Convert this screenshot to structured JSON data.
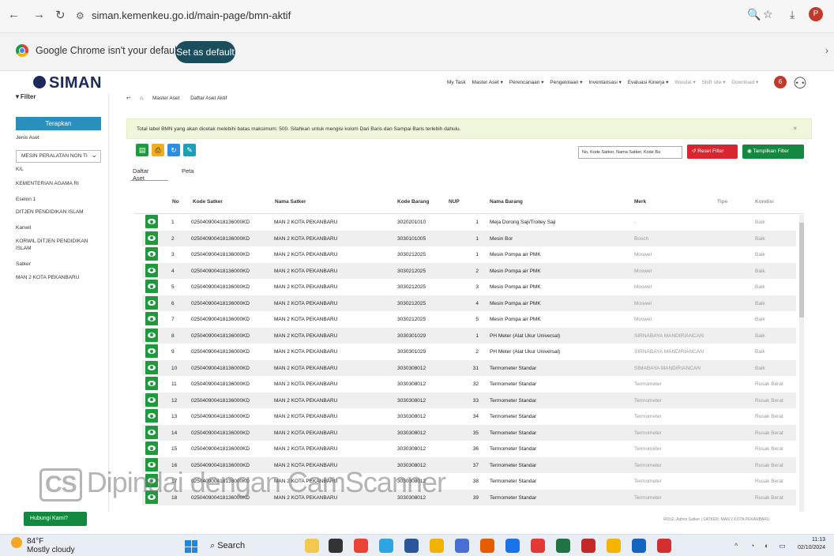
{
  "browser": {
    "url": "siman.kemenkeu.go.id/main-page/bmn-aktif",
    "infobar_text": "Google Chrome isn't your default browser",
    "set_default_label": "Set as default"
  },
  "app": {
    "logo": "SIMAN",
    "nav": [
      "My Task",
      "Master Aset ▾",
      "Perencanaan ▾",
      "Pengelolaan ▾",
      "Inventarisasi ▾",
      "Evaluasi Kinerja ▾",
      "Wasdal ▾",
      "Shift site ▾",
      "Download ▾"
    ],
    "notif_count": "6"
  },
  "sidebar": {
    "filter_label": "Filter",
    "apply_label": "Terapkan",
    "fields": [
      {
        "label": "Jenis Aset",
        "value": "MESIN PERALATAN NON TI"
      },
      {
        "label": "K/L",
        "value": "KEMENTERIAN AGAMA RI"
      },
      {
        "label": "Eselon 1",
        "value": "DITJEN PENDIDIKAN ISLAM"
      },
      {
        "label": "Kanwil",
        "value": "KORWIL DITJEN PENDIDIKAN ISLAM"
      },
      {
        "label": "Satker",
        "value": "MAN 2 KOTA PEKANBARU"
      }
    ]
  },
  "breadcrumb": [
    "Master Aset",
    "Daftar Aset Aktif"
  ],
  "alert": {
    "text": "Total label BMN yang akan dicetak melebihi batas maksimum: 500. Silahkan untuk mengisi kolom Dari Baris dan Sampai Baris terlebih dahulu.",
    "close": "×"
  },
  "toolbar": {
    "search_placeholder": "No, Kode Satker, Nama Satker, Kode Ba",
    "reset_label": "Reset Filter",
    "show_label": "Tampilkan Filter"
  },
  "tabs": [
    "Daftar Aset",
    "Peta"
  ],
  "table": {
    "headers": [
      "No",
      "Kode Satker",
      "Nama Satker",
      "Kode Barang",
      "NUP",
      "Nama Barang",
      "Merk",
      "Tipe",
      "Kondisi"
    ],
    "rows": [
      {
        "no": "1",
        "kode_satker": "025040900418136000KD",
        "nama_satker": "MAN 2 KOTA PEKANBARU",
        "kode_barang": "3020201010",
        "nup": "1",
        "nama_barang": "Meja Dorong Saji/Trolley Saji",
        "merk": "-",
        "kondisi": "Baik"
      },
      {
        "no": "2",
        "kode_satker": "025040900418136000KD",
        "nama_satker": "MAN 2 KOTA PEKANBARU",
        "kode_barang": "3030101005",
        "nup": "1",
        "nama_barang": "Mesin Bor",
        "merk": "Bosch",
        "kondisi": "Baik"
      },
      {
        "no": "3",
        "kode_satker": "025040900418136000KD",
        "nama_satker": "MAN 2 KOTA PEKANBARU",
        "kode_barang": "3030212025",
        "nup": "1",
        "nama_barang": "Mesin Pompa air PMK",
        "merk": "Moswel",
        "kondisi": "Baik"
      },
      {
        "no": "4",
        "kode_satker": "025040900418136000KD",
        "nama_satker": "MAN 2 KOTA PEKANBARU",
        "kode_barang": "3030212025",
        "nup": "2",
        "nama_barang": "Mesin Pompa air PMK",
        "merk": "Moswel",
        "kondisi": "Baik"
      },
      {
        "no": "5",
        "kode_satker": "025040900418136000KD",
        "nama_satker": "MAN 2 KOTA PEKANBARU",
        "kode_barang": "3030212025",
        "nup": "3",
        "nama_barang": "Mesin Pompa air PMK",
        "merk": "Moswel",
        "kondisi": "Baik"
      },
      {
        "no": "6",
        "kode_satker": "025040900418136000KD",
        "nama_satker": "MAN 2 KOTA PEKANBARU",
        "kode_barang": "3030212025",
        "nup": "4",
        "nama_barang": "Mesin Pompa air PMK",
        "merk": "Moswel",
        "kondisi": "Baik"
      },
      {
        "no": "7",
        "kode_satker": "025040900418136000KD",
        "nama_satker": "MAN 2 KOTA PEKANBARU",
        "kode_barang": "3030212025",
        "nup": "5",
        "nama_barang": "Mesin Pompa air PMK",
        "merk": "Moswel",
        "kondisi": "Baik"
      },
      {
        "no": "8",
        "kode_satker": "025040900418136000KD",
        "nama_satker": "MAN 2 KOTA PEKANBARU",
        "kode_barang": "3030301029",
        "nup": "1",
        "nama_barang": "PH Meter (Alat Ukur Universal)",
        "merk": "SIRNABAYA MANDIRIANCAN",
        "kondisi": "Baik"
      },
      {
        "no": "9",
        "kode_satker": "025040900418136000KD",
        "nama_satker": "MAN 2 KOTA PEKANBARU",
        "kode_barang": "3030301029",
        "nup": "2",
        "nama_barang": "PH Meter (Alat Ukur Universal)",
        "merk": "SIRNABAYA MANDIRIANCAN",
        "kondisi": "Baik"
      },
      {
        "no": "10",
        "kode_satker": "025040900418136000KD",
        "nama_satker": "MAN 2 KOTA PEKANBARU",
        "kode_barang": "3030308012",
        "nup": "31",
        "nama_barang": "Termometer Standar",
        "merk": "SIMABAYA MANDIRIANCAN",
        "kondisi": "Baik"
      },
      {
        "no": "11",
        "kode_satker": "025040900418136000KD",
        "nama_satker": "MAN 2 KOTA PEKANBARU",
        "kode_barang": "3030308012",
        "nup": "32",
        "nama_barang": "Termometer Standar",
        "merk": "Termometer",
        "kondisi": "Rusak Berat"
      },
      {
        "no": "12",
        "kode_satker": "025040900418136000KD",
        "nama_satker": "MAN 2 KOTA PEKANBARU",
        "kode_barang": "3030308012",
        "nup": "33",
        "nama_barang": "Termometer Standar",
        "merk": "Termometer",
        "kondisi": "Rusak Berat"
      },
      {
        "no": "13",
        "kode_satker": "025040900418136000KD",
        "nama_satker": "MAN 2 KOTA PEKANBARU",
        "kode_barang": "3030308012",
        "nup": "34",
        "nama_barang": "Termometer Standar",
        "merk": "Termometer",
        "kondisi": "Rusak Berat"
      },
      {
        "no": "14",
        "kode_satker": "025040900418136000KD",
        "nama_satker": "MAN 2 KOTA PEKANBARU",
        "kode_barang": "3030308012",
        "nup": "35",
        "nama_barang": "Termometer Standar",
        "merk": "Termometer",
        "kondisi": "Rusak Berat"
      },
      {
        "no": "15",
        "kode_satker": "025040900418136000KD",
        "nama_satker": "MAN 2 KOTA PEKANBARU",
        "kode_barang": "3030308012",
        "nup": "36",
        "nama_barang": "Termometer Standar",
        "merk": "Termometer",
        "kondisi": "Rusak Berat"
      },
      {
        "no": "16",
        "kode_satker": "025040900418136000KD",
        "nama_satker": "MAN 2 KOTA PEKANBARU",
        "kode_barang": "3030308012",
        "nup": "37",
        "nama_barang": "Termometer Standar",
        "merk": "Termometer",
        "kondisi": "Rusak Berat"
      },
      {
        "no": "17",
        "kode_satker": "025040900418136000KD",
        "nama_satker": "MAN 2 KOTA PEKANBARU",
        "kode_barang": "3030308012",
        "nup": "38",
        "nama_barang": "Termometer Standar",
        "merk": "Termometer",
        "kondisi": "Rusak Berat"
      },
      {
        "no": "18",
        "kode_satker": "025040900418136000KD",
        "nama_satker": "MAN 2 KOTA PEKANBARU",
        "kode_barang": "3030308012",
        "nup": "39",
        "nama_barang": "Termometer Standar",
        "merk": "Termometer",
        "kondisi": "Rusak Berat"
      }
    ]
  },
  "footer": {
    "info": "ROLE: Admin Satker | SATKER: MAN 2 KOTA PEKANBARU",
    "help_label": "Hubungi Kami?"
  },
  "watermark": {
    "badge": "CS",
    "text": "Dipindai dengan CamScanner"
  },
  "taskbar": {
    "temp": "84°F",
    "weather": "Mostly cloudy",
    "search": "Search",
    "time": "11:13",
    "date": "02/10/2024"
  }
}
